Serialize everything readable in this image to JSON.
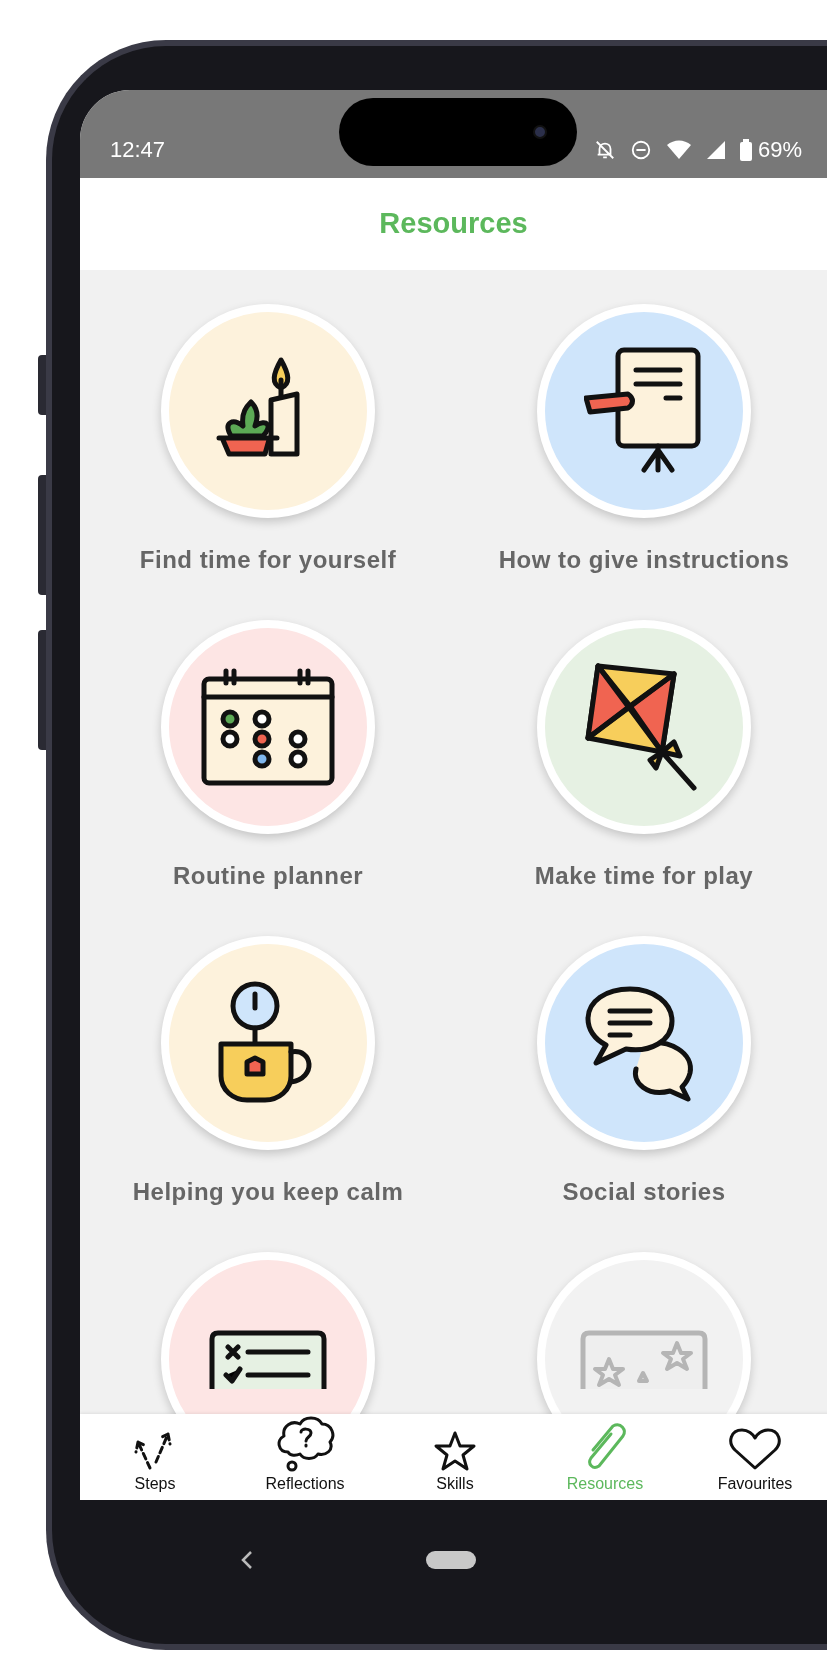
{
  "status_bar": {
    "time": "12:47",
    "battery": "69%"
  },
  "header": {
    "title": "Resources"
  },
  "resources": [
    {
      "label": "Find time for yourself",
      "kind": "candle",
      "color": "#fdf2dc"
    },
    {
      "label": "How to give instructions",
      "kind": "easel",
      "color": "#cfe5fb"
    },
    {
      "label": "Routine planner",
      "kind": "calendar",
      "color": "#fde5e4"
    },
    {
      "label": "Make time for play",
      "kind": "kite",
      "color": "#e6f1e3"
    },
    {
      "label": "Helping you keep calm",
      "kind": "teacup",
      "color": "#fdf2dc"
    },
    {
      "label": "Social stories",
      "kind": "chat",
      "color": "#cfe5fb"
    },
    {
      "kind": "checklist",
      "color": "#fde5e4"
    },
    {
      "kind": "stars",
      "color": "#f2f2f2"
    }
  ],
  "nav": [
    {
      "label": "Steps",
      "kind": "steps",
      "selected": false
    },
    {
      "label": "Reflections",
      "kind": "thought",
      "selected": false
    },
    {
      "label": "Skills",
      "kind": "star",
      "selected": false
    },
    {
      "label": "Resources",
      "kind": "clip",
      "selected": true
    },
    {
      "label": "Favourites",
      "kind": "heart",
      "selected": false
    }
  ]
}
